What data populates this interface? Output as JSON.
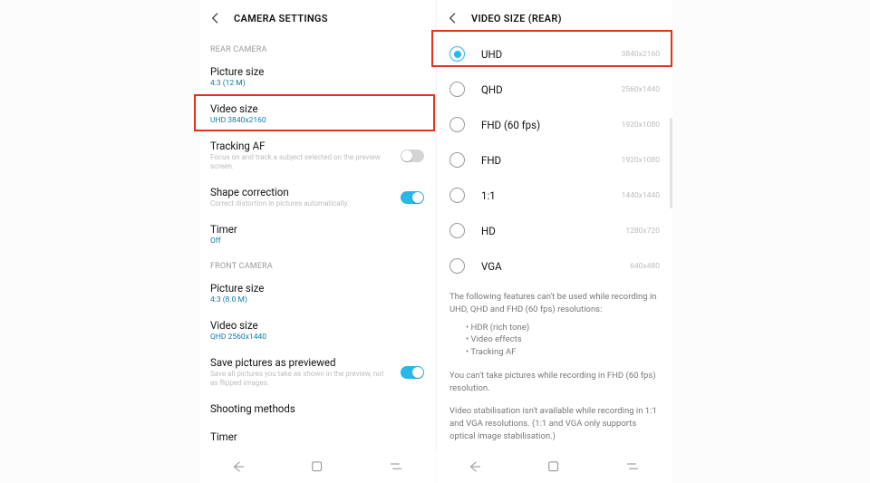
{
  "left": {
    "title": "CAMERA SETTINGS",
    "sections": {
      "rear": {
        "head": "REAR CAMERA",
        "picture_size": {
          "title": "Picture size",
          "sub": "4:3 (12 M)"
        },
        "video_size": {
          "title": "Video size",
          "sub": "UHD 3840x2160"
        },
        "tracking_af": {
          "title": "Tracking AF",
          "desc": "Focus on and track a subject selected on the preview screen."
        },
        "shape_corr": {
          "title": "Shape correction",
          "desc": "Correct distortion in pictures automatically."
        },
        "timer": {
          "title": "Timer",
          "sub": "Off"
        }
      },
      "front": {
        "head": "FRONT CAMERA",
        "picture_size": {
          "title": "Picture size",
          "sub": "4:3 (8.0 M)"
        },
        "video_size": {
          "title": "Video size",
          "sub": "QHD 2560x1440"
        },
        "save_prev": {
          "title": "Save pictures as previewed",
          "desc": "Save all pictures you take as shown in the preview, not as flipped images."
        },
        "shooting": {
          "title": "Shooting methods"
        },
        "timer": {
          "title": "Timer"
        }
      }
    }
  },
  "right": {
    "title": "VIDEO SIZE (REAR)",
    "options": [
      {
        "label": "UHD",
        "res": "3840x2160",
        "selected": true
      },
      {
        "label": "QHD",
        "res": "2560x1440",
        "selected": false
      },
      {
        "label": "FHD (60 fps)",
        "res": "1920x1080",
        "selected": false
      },
      {
        "label": "FHD",
        "res": "1920x1080",
        "selected": false
      },
      {
        "label": "1:1",
        "res": "1440x1440",
        "selected": false
      },
      {
        "label": "HD",
        "res": "1280x720",
        "selected": false
      },
      {
        "label": "VGA",
        "res": "640x480",
        "selected": false
      }
    ],
    "notes": {
      "p1": "The following features can't be used while recording in UHD, QHD and FHD (60 fps) resolutions:",
      "b1": "• HDR (rich tone)",
      "b2": "• Video effects",
      "b3": "• Tracking AF",
      "p2": "You can't take pictures while recording in FHD (60 fps) resolution.",
      "p3": "Video stabilisation isn't available while recording in 1:1 and VGA resolutions. (1:1 and VGA only supports optical image stabilisation.)"
    }
  }
}
